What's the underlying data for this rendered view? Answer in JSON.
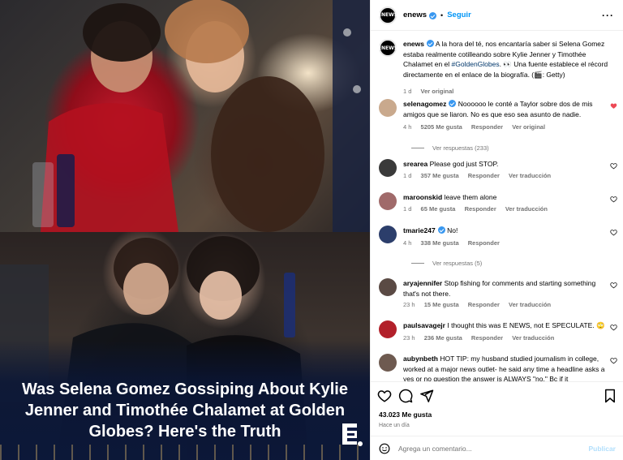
{
  "media": {
    "headline": "Was Selena Gomez Gossiping About Kylie Jenner and Timothée Chalamet at Golden Globes? Here's the Truth",
    "logo": "e-logo-icon"
  },
  "header": {
    "avatar_text": "ENEWS",
    "username": "enews",
    "follow_label": "Seguir",
    "more_icon": "more-icon"
  },
  "caption": {
    "username": "enews",
    "text_before_hashtag": " A la hora del té, nos encantaría saber si Selena Gomez estaba realmente cotilleando sobre Kylie Jenner y Timothée Chalamet en el ",
    "hashtag": "#GoldenGlobes",
    "text_after_hashtag": ". 👀 Una fuente establece el récord directamente en el enlace de la biografía. (🎬: Getty)",
    "time": "1 d",
    "see_original": "Ver original"
  },
  "comments": [
    {
      "username": "selenagomez",
      "verified": true,
      "text": "Noooooo le conté a Taylor sobre dos de mis amigos que se liaron. No es que eso sea asunto de nadie.",
      "time": "4 h",
      "likes": "5205 Me gusta",
      "reply": "Responder",
      "extra": "Ver original",
      "liked": true,
      "replies": "Ver respuestas (233)",
      "avatar_color": "#c9a98d"
    },
    {
      "username": "srearea",
      "verified": false,
      "text": "Please god just STOP.",
      "time": "1 d",
      "likes": "357 Me gusta",
      "reply": "Responder",
      "extra": "Ver traducción",
      "liked": false,
      "avatar_color": "#3a3a3a"
    },
    {
      "username": "maroonskid",
      "verified": false,
      "text": "leave them alone",
      "time": "1 d",
      "likes": "65 Me gusta",
      "reply": "Responder",
      "extra": "Ver traducción",
      "liked": false,
      "avatar_color": "#a06a6a"
    },
    {
      "username": "tmarie247",
      "verified": true,
      "text": "No!",
      "time": "4 h",
      "likes": "338 Me gusta",
      "reply": "Responder",
      "extra": "",
      "liked": false,
      "replies": "Ver respuestas (5)",
      "avatar_color": "#2c3e6b"
    },
    {
      "username": "aryajennifer",
      "verified": false,
      "text": "Stop fishing for comments and starting something that's not there.",
      "time": "23 h",
      "likes": "15 Me gusta",
      "reply": "Responder",
      "extra": "Ver traducción",
      "liked": false,
      "avatar_color": "#5a4a44"
    },
    {
      "username": "paulsavagejr",
      "verified": false,
      "text": "I thought this was E NEWS, not E SPECULATE. 🙄",
      "time": "23 h",
      "likes": "236 Me gusta",
      "reply": "Responder",
      "extra": "Ver traducción",
      "liked": false,
      "avatar_color": "#b2202a"
    },
    {
      "username": "aubynbeth",
      "verified": false,
      "text": "HOT TIP: my husband studied journalism in college, worked at a major news outlet- he said any time a headline asks a yes or no question the answer is ALWAYS \"no.\" Bc if it",
      "time": "",
      "likes": "",
      "reply": "",
      "extra": "",
      "liked": false,
      "avatar_color": "#6e5a50"
    }
  ],
  "actions": {
    "likes": "43.023 Me gusta",
    "time_ago": "Hace un día",
    "comment_placeholder": "Agrega un comentario...",
    "publish_label": "Publicar"
  },
  "colors": {
    "link_blue": "#0095f6",
    "heart_red": "#ed4956",
    "muted": "#737373"
  }
}
